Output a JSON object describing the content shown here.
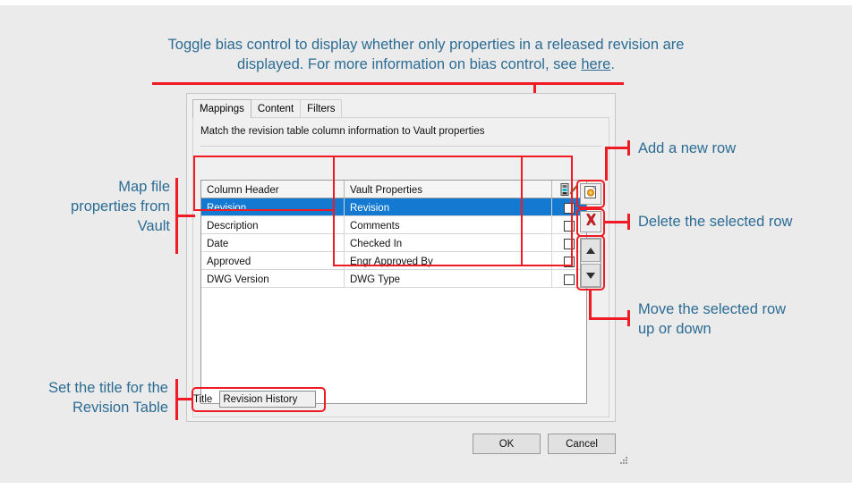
{
  "annotations": {
    "top": {
      "text_before": "Toggle bias control to display whether only properties in a released revision are displayed. For more information on bias control, see ",
      "link_text": "here",
      "text_after": "."
    },
    "left_map": "Map file\nproperties from\nVault",
    "left_title": "Set the title for the\nRevision Table",
    "right_add": "Add a new row",
    "right_delete": "Delete the selected row",
    "right_move": "Move the selected row\nup or down",
    "color_red": "#EE1B24",
    "color_text": "#2C6C94"
  },
  "dialog": {
    "tabs": [
      {
        "label": "Mappings",
        "active": true
      },
      {
        "label": "Content",
        "active": false
      },
      {
        "label": "Filters",
        "active": false
      }
    ],
    "panel_description": "Match the revision table column information to Vault properties",
    "grid": {
      "headers": [
        "Column Header",
        "Vault Properties",
        "bias-icon"
      ],
      "rows": [
        {
          "column_header": "Revision",
          "vault_property": "Revision",
          "bias_checked": false,
          "selected": true
        },
        {
          "column_header": "Description",
          "vault_property": "Comments",
          "bias_checked": false,
          "selected": false
        },
        {
          "column_header": "Date",
          "vault_property": "Checked In",
          "bias_checked": false,
          "selected": false
        },
        {
          "column_header": "Approved",
          "vault_property": "Engr Approved By",
          "bias_checked": false,
          "selected": false
        },
        {
          "column_header": "DWG Version",
          "vault_property": "DWG Type",
          "bias_checked": false,
          "selected": false
        }
      ]
    },
    "side_buttons": {
      "add": "add-row-icon",
      "delete": "delete-row-icon",
      "move_up": "move-up-icon",
      "move_down": "move-down-icon"
    },
    "title_field": {
      "label": "Title",
      "value": "Revision History",
      "placeholder": ""
    },
    "footer": {
      "ok": "OK",
      "cancel": "Cancel"
    },
    "selection_color": "#1479D1"
  }
}
